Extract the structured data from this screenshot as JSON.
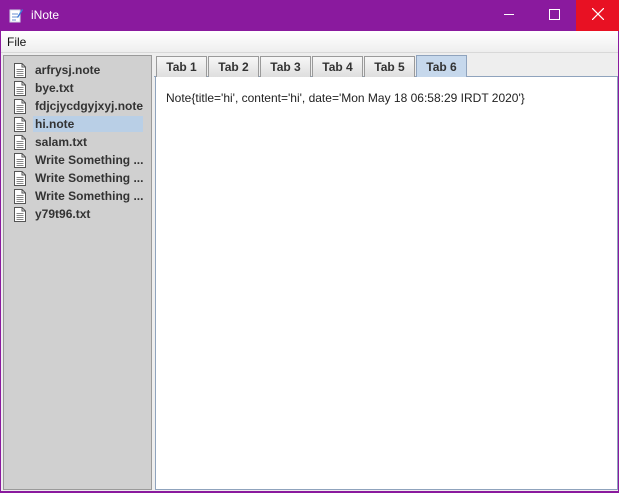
{
  "window": {
    "title": "iNote",
    "app_icon": "notepad-pen-icon",
    "controls": [
      "minimize-icon",
      "maximize-icon",
      "close-icon"
    ]
  },
  "menu": {
    "file": "File"
  },
  "files": [
    {
      "name": "arfrysj.note",
      "icon": "document-icon"
    },
    {
      "name": "bye.txt",
      "icon": "document-icon"
    },
    {
      "name": "fdjcjycdgyjxyj.note",
      "icon": "document-icon"
    },
    {
      "name": "hi.note",
      "icon": "document-icon",
      "selected": true
    },
    {
      "name": "salam.txt",
      "icon": "document-icon"
    },
    {
      "name": "Write Something ...",
      "icon": "document-icon"
    },
    {
      "name": "Write Something ...",
      "icon": "document-icon"
    },
    {
      "name": "Write Something ...",
      "icon": "document-icon"
    },
    {
      "name": "y79t96.txt",
      "icon": "document-icon"
    }
  ],
  "tabs": [
    {
      "label": "Tab 1"
    },
    {
      "label": "Tab 2"
    },
    {
      "label": "Tab 3"
    },
    {
      "label": "Tab 4"
    },
    {
      "label": "Tab 5"
    },
    {
      "label": "Tab 6",
      "active": true
    }
  ],
  "content": {
    "text": "Note{title='hi', content='hi', date='Mon May 18 06:58:29 IRDT 2020'}"
  },
  "colors": {
    "titlebar": "#8a1a9e",
    "close_button": "#e81123",
    "selection": "#b9cfe6",
    "active_tab": "#c6d8ec"
  }
}
